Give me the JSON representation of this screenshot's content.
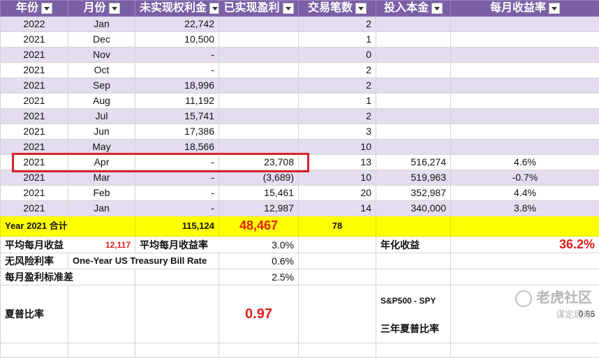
{
  "headers": [
    "年份",
    "月份",
    "未实现权利金",
    "已实现盈利",
    "交易笔数",
    "投入本金",
    "每月收益率"
  ],
  "rows": [
    {
      "year": "2022",
      "month": "Jan",
      "unrealized": "22,742",
      "realized": "",
      "trades": "2",
      "capital": "",
      "rate": ""
    },
    {
      "year": "2021",
      "month": "Dec",
      "unrealized": "10,500",
      "realized": "",
      "trades": "1",
      "capital": "",
      "rate": ""
    },
    {
      "year": "2021",
      "month": "Nov",
      "unrealized": "-",
      "realized": "",
      "trades": "0",
      "capital": "",
      "rate": ""
    },
    {
      "year": "2021",
      "month": "Oct",
      "unrealized": "-",
      "realized": "",
      "trades": "2",
      "capital": "",
      "rate": ""
    },
    {
      "year": "2021",
      "month": "Sep",
      "unrealized": "18,996",
      "realized": "",
      "trades": "2",
      "capital": "",
      "rate": ""
    },
    {
      "year": "2021",
      "month": "Aug",
      "unrealized": "11,192",
      "realized": "",
      "trades": "1",
      "capital": "",
      "rate": ""
    },
    {
      "year": "2021",
      "month": "Jul",
      "unrealized": "15,741",
      "realized": "",
      "trades": "2",
      "capital": "",
      "rate": ""
    },
    {
      "year": "2021",
      "month": "Jun",
      "unrealized": "17,386",
      "realized": "",
      "trades": "3",
      "capital": "",
      "rate": ""
    },
    {
      "year": "2021",
      "month": "May",
      "unrealized": "18,566",
      "realized": "",
      "trades": "10",
      "capital": "",
      "rate": ""
    },
    {
      "year": "2021",
      "month": "Apr",
      "unrealized": "-",
      "realized": "23,708",
      "trades": "13",
      "capital": "516,274",
      "rate": "4.6%"
    },
    {
      "year": "2021",
      "month": "Mar",
      "unrealized": "-",
      "realized": "(3,689)",
      "trades": "10",
      "capital": "519,963",
      "rate": "-0.7%"
    },
    {
      "year": "2021",
      "month": "Feb",
      "unrealized": "-",
      "realized": "15,461",
      "trades": "20",
      "capital": "352,987",
      "rate": "4.4%"
    },
    {
      "year": "2021",
      "month": "Jan",
      "unrealized": "-",
      "realized": "12,987",
      "trades": "14",
      "capital": "340,000",
      "rate": "3.8%"
    }
  ],
  "total": {
    "label": "Year 2021 合计",
    "unrealized": "115,124",
    "realized": "48,467",
    "trades": "78"
  },
  "stats": {
    "avg_monthly_label": "平均每月收益",
    "avg_monthly_value": "12,117",
    "avg_rate_label": "平均每月收益率",
    "avg_rate_value": "3.0%",
    "annual_label": "年化收益",
    "annual_value": "36.2%",
    "riskfree_label": "无风险利率",
    "riskfree_desc": "One-Year US Treasury Bill Rate",
    "riskfree_value": "0.6%",
    "std_label": "每月盈利标准差",
    "std_value": "2.5%",
    "sharpe_label": "夏普比率",
    "sharpe_value": "0.97",
    "spy_line1": "S&P500 - SPY",
    "spy_line2": "三年夏普比率",
    "spy_value": "0.86"
  },
  "watermark": {
    "main": "老虎社区",
    "sub": "谋定后动"
  },
  "colors": {
    "header": "#7b5fa6",
    "band": "#e3ddef",
    "total": "#ffff00",
    "red": "#e01e1e",
    "highlight": "#d9232b"
  }
}
